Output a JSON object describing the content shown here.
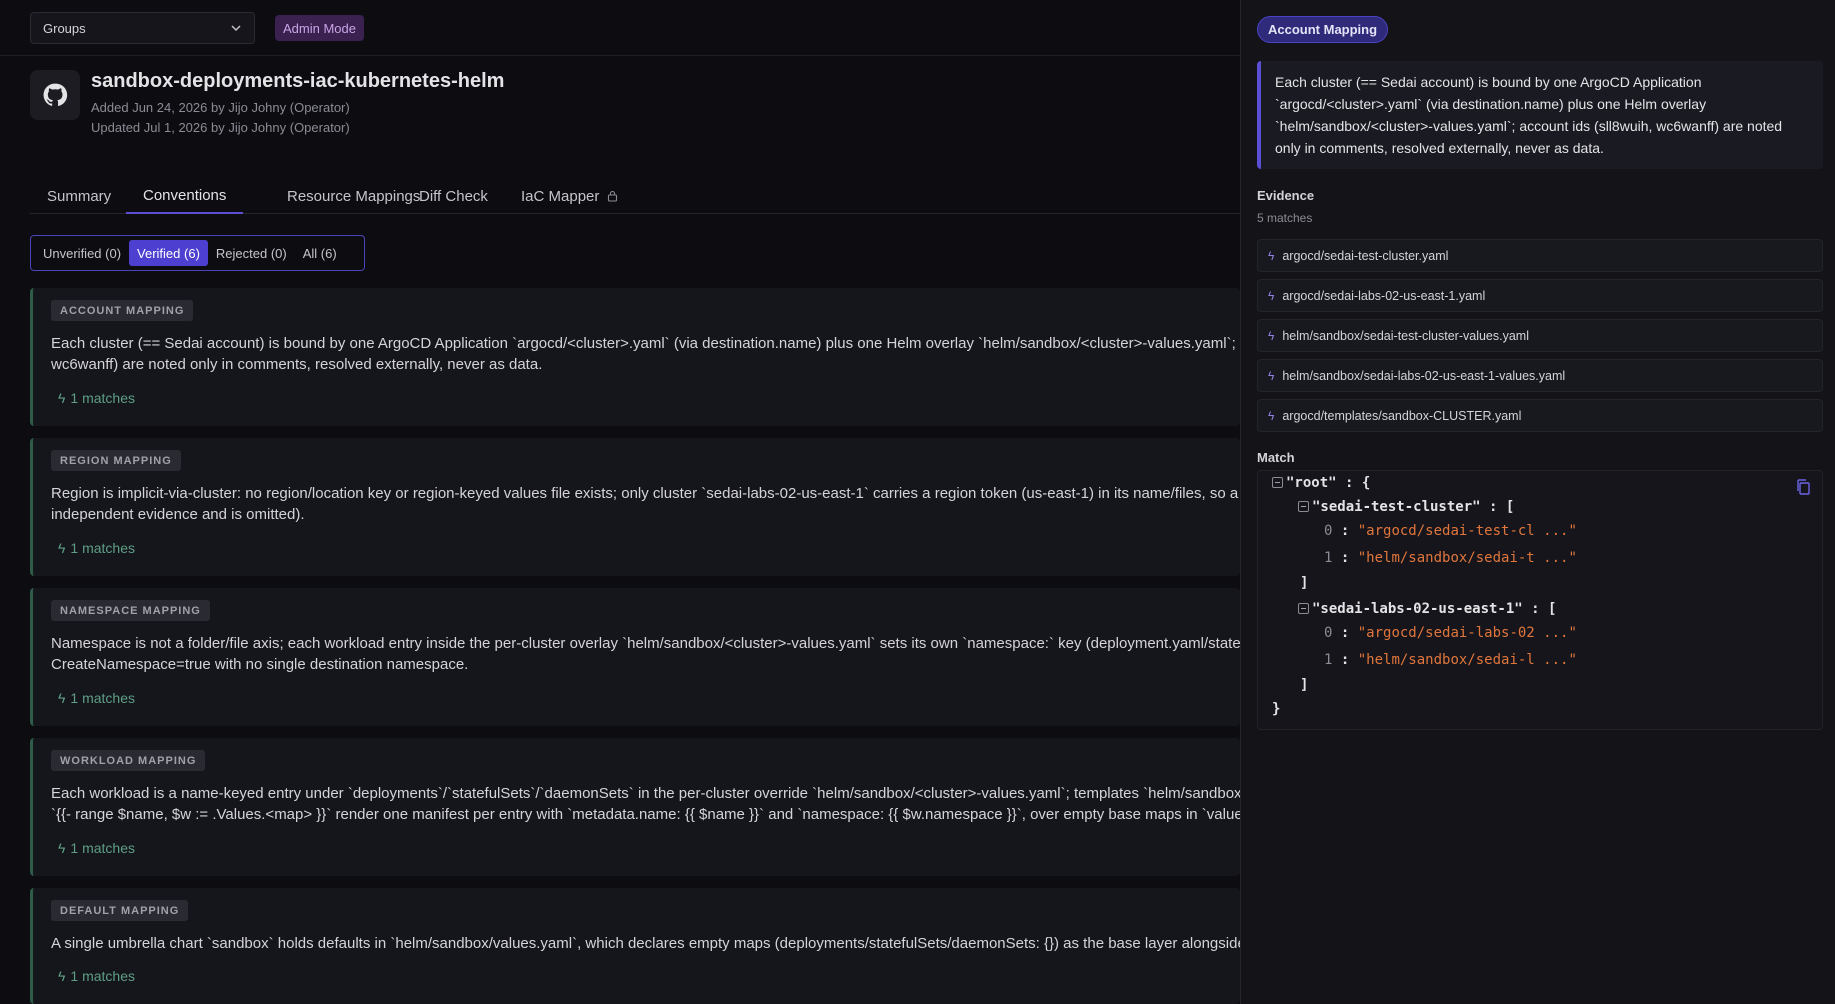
{
  "topbar": {
    "groups_value": "Groups",
    "admin_mode": "Admin Mode"
  },
  "repo": {
    "title": "sandbox-deployments-iac-kubernetes-helm",
    "added": "Added Jun 24, 2026 by Jijo Johny (Operator)",
    "updated": "Updated Jul 1, 2026 by Jijo Johny (Operator)"
  },
  "tabs": [
    {
      "label": "Summary"
    },
    {
      "label": "Conventions"
    },
    {
      "label": "Resource Mappings"
    },
    {
      "label": "Diff Check"
    },
    {
      "label": "IaC Mapper"
    }
  ],
  "filters": [
    {
      "label": "Unverified (0)"
    },
    {
      "label": "Verified (6)"
    },
    {
      "label": "Rejected (0)"
    },
    {
      "label": "All (6)"
    }
  ],
  "cards": [
    {
      "badge": "ACCOUNT MAPPING",
      "text": "Each cluster (== Sedai account) is bound by one ArgoCD Application `argocd/<cluster>.yaml` (via destination.name) plus one Helm overlay `helm/sandbox/<cluster>-values.yaml`; account ids (sll8wuih, wc6wanff) are noted only in comments, resolved externally, never as data.",
      "matches": "1 matches"
    },
    {
      "badge": "REGION MAPPING",
      "text": "Region is implicit-via-cluster: no region/location key or region-keyed values file exists; only cluster `sedai-labs-02-us-east-1` carries a region token (us-east-1) in its name/files, so a region dimension has no independent evidence and is omitted).",
      "matches": "1 matches"
    },
    {
      "badge": "NAMESPACE MAPPING",
      "text": "Namespace is not a folder/file axis; each workload entry inside the per-cluster overlay `helm/sandbox/<cluster>-values.yaml` sets its own `namespace:` key (deployment.yaml/statefulset.yaml), and ArgoCD uses CreateNamespace=true with no single destination namespace.",
      "matches": "1 matches"
    },
    {
      "badge": "WORKLOAD MAPPING",
      "text": "Each workload is a name-keyed entry under `deployments`/`statefulSets`/`daemonSets` in the per-cluster override `helm/sandbox/<cluster>-values.yaml`; templates `helm/sandbox/templates/*.yaml` range over `{{- range $name, $w := .Values.<map> }}` render one manifest per entry with `metadata.name: {{ $name }}` and `namespace: {{ $w.namespace }}`, over empty base maps in `values.yaml`, ArgoCD `valueFiles`.",
      "matches": "1 matches"
    },
    {
      "badge": "DEFAULT MAPPING",
      "text": "A single umbrella chart `sandbox` holds defaults in `helm/sandbox/values.yaml`, which declares empty maps (deployments/statefulSets/daemonSets: {}) as the base layer alongside per-cluster overrides.",
      "matches": "1 matches"
    }
  ],
  "panel": {
    "badge": "Account Mapping",
    "description": "Each cluster (== Sedai account) is bound by one ArgoCD Application `argocd/<cluster>.yaml` (via destination.name) plus one Helm overlay `helm/sandbox/<cluster>-values.yaml`; account ids (sll8wuih, wc6wanff) are noted only in comments, resolved externally, never as data.",
    "evidence_label": "Evidence",
    "evidence_count": "5 matches",
    "evidence": [
      "argocd/sedai-test-cluster.yaml",
      "argocd/sedai-labs-02-us-east-1.yaml",
      "helm/sandbox/sedai-test-cluster-values.yaml",
      "helm/sandbox/sedai-labs-02-us-east-1-values.yaml",
      "argocd/templates/sandbox-CLUSTER.yaml"
    ],
    "match_label": "Match",
    "json": {
      "root_key": "\"root\"",
      "k1": "\"sedai-test-cluster\"",
      "k1_0": "\"argocd/sedai-test-cl ...\"",
      "k1_1": "\"helm/sandbox/sedai-t ...\"",
      "k2": "\"sedai-labs-02-us-east-1\"",
      "k2_0": "\"argocd/sedai-labs-02 ...\"",
      "k2_1": "\"helm/sandbox/sedai-l ...\""
    }
  }
}
